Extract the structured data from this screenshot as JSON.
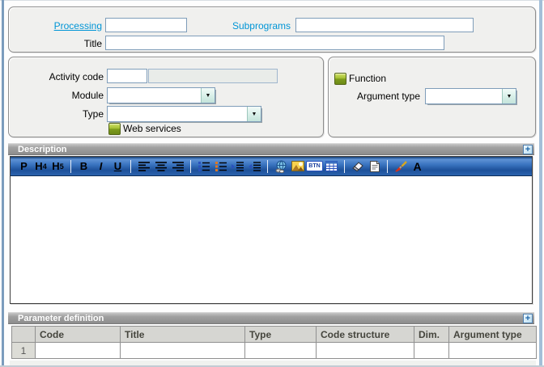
{
  "header": {
    "processing_label": "Processing",
    "processing_value": "",
    "subprograms_label": "Subprograms",
    "subprograms_value": "",
    "title_label": "Title",
    "title_value": ""
  },
  "details": {
    "activity_code_label": "Activity code",
    "activity_code_value": "",
    "activity_code_desc": "",
    "module_label": "Module",
    "module_value": "",
    "type_label": "Type",
    "type_value": "",
    "web_services_label": "Web services",
    "function_label": "Function",
    "argument_type_label": "Argument type",
    "argument_type_value": ""
  },
  "description_section": {
    "title": "Description",
    "expand_glyph": "+",
    "toolbar": {
      "paragraph": "P",
      "h4": {
        "letter": "H",
        "sub": "4"
      },
      "h5": {
        "letter": "H",
        "sub": "5"
      },
      "bold": "B",
      "italic": "I",
      "underline": "U",
      "button_label": "BTN",
      "font_letter": "A"
    },
    "content": ""
  },
  "parameters_section": {
    "title": "Parameter definition",
    "expand_glyph": "+",
    "table": {
      "columns": [
        "Code",
        "Title",
        "Type",
        "Code structure",
        "Dim.",
        "Argument type"
      ],
      "rows": [
        {
          "num": "1",
          "code": "",
          "title": "",
          "type": "",
          "code_structure": "",
          "dim": "",
          "argument_type": ""
        }
      ]
    }
  },
  "ui": {
    "combo_arrow_glyph": "▼",
    "colors": {
      "link_blue": "#0095d6",
      "field_border_blue": "#7f9db9",
      "toolbar_blue": "#2a62ad",
      "section_header_gray": "#9a9a9a",
      "checkbox_green": "#8aa81e",
      "groupbox_fill": "#f0f0ee"
    }
  }
}
